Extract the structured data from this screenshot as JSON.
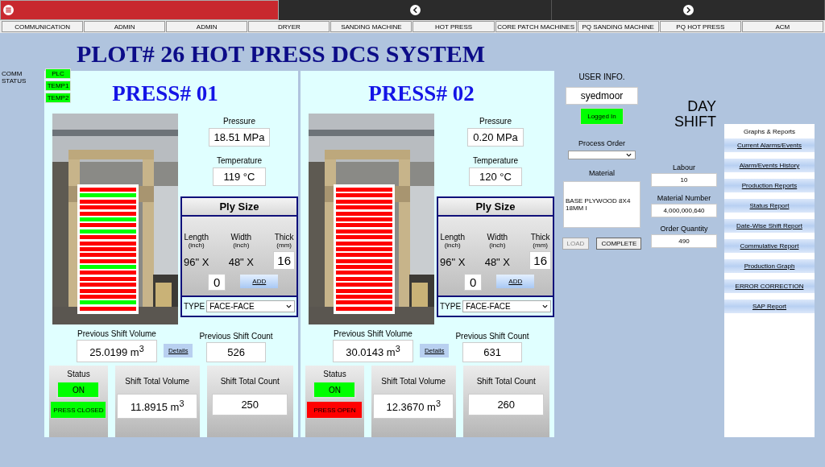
{
  "topbar": [
    {
      "kind": "menu",
      "selected": true
    },
    {
      "kind": "back",
      "selected": false
    },
    {
      "kind": "forward",
      "selected": false
    }
  ],
  "nav_tabs": [
    {
      "label": "COMMUNICATION",
      "selected": false
    },
    {
      "label": "ADMIN",
      "selected": false
    },
    {
      "label": "ADMIN",
      "selected": false
    },
    {
      "label": "DRYER",
      "selected": false
    },
    {
      "label": "SANDING MACHINE",
      "selected": false
    },
    {
      "label": "HOT PRESS",
      "selected": false
    },
    {
      "label": "CORE PATCH MACHINES",
      "selected": false
    },
    {
      "label": "PQ SANDING MACHINE",
      "selected": false
    },
    {
      "label": "PQ HOT PRESS",
      "selected": false
    },
    {
      "label": "ACM",
      "selected": false
    }
  ],
  "title": "PLOT# 26 HOT PRESS DCS SYSTEM",
  "comm_status": {
    "label": "COMM STATUS",
    "items": [
      {
        "label": "PLC",
        "ok": true
      },
      {
        "label": "TEMP1",
        "ok": true
      },
      {
        "label": "TEMP2",
        "ok": true
      }
    ]
  },
  "presses": [
    {
      "title": "PRESS# 01",
      "pressure_label": "Pressure",
      "pressure": "18.51 MPa",
      "temperature_label": "Temperature",
      "temperature": "119 °C",
      "plies": [
        {
          "color": "#ff0000"
        },
        {
          "color": "#00ff00"
        },
        {
          "color": "#ff0000"
        },
        {
          "color": "#ff0000"
        },
        {
          "color": "#ff0000"
        },
        {
          "color": "#00ff00"
        },
        {
          "color": "#ff0000"
        },
        {
          "color": "#00ff00"
        },
        {
          "color": "#ff0000"
        },
        {
          "color": "#ff0000"
        },
        {
          "color": "#ff0000"
        },
        {
          "color": "#ff0000"
        },
        {
          "color": "#ff0000"
        },
        {
          "color": "#00ff00"
        },
        {
          "color": "#ff0000"
        },
        {
          "color": "#ff0000"
        },
        {
          "color": "#ff0000"
        },
        {
          "color": "#ff0000"
        },
        {
          "color": "#ff0000"
        },
        {
          "color": "#00ff00"
        },
        {
          "color": "#ff0000"
        }
      ],
      "ply_size": {
        "title": "Ply Size",
        "columns": [
          {
            "label": "Length",
            "unit": "(inch)",
            "value": "96\" X",
            "kind": "text"
          },
          {
            "label": "Width",
            "unit": "(inch)",
            "value": "48\" X",
            "kind": "text"
          },
          {
            "label": "Thick",
            "unit": "(mm)",
            "value": "16",
            "kind": "field"
          }
        ],
        "count": "0",
        "add": "ADD",
        "type_label": "TYPE",
        "type": "FACE-FACE"
      },
      "prev_volume_label": "Previous Shift Volume",
      "prev_volume": "25.0199 m$^{3}$",
      "details": "Details",
      "prev_count_label": "Previous Shift Count",
      "prev_count": "526",
      "status_label": "Status",
      "status": "ON",
      "on": true,
      "press_state": "PRESS CLOSED",
      "closed": true,
      "total_volume_label": "Shift Total Volume",
      "total_volume": "11.8915 m$^{3}$",
      "total_count_label": "Shift Total Count",
      "total_count": "250"
    },
    {
      "title": "PRESS# 02",
      "pressure_label": "Pressure",
      "pressure": "0.20 MPa",
      "temperature_label": "Temperature",
      "temperature": "120 °C",
      "plies": [
        {
          "color": "#ff0000"
        },
        {
          "color": "#ff0000"
        },
        {
          "color": "#ff0000"
        },
        {
          "color": "#ff0000"
        },
        {
          "color": "#ff0000"
        },
        {
          "color": "#ff0000"
        },
        {
          "color": "#ff0000"
        },
        {
          "color": "#ff0000"
        },
        {
          "color": "#ff0000"
        },
        {
          "color": "#ff0000"
        },
        {
          "color": "#ff0000"
        },
        {
          "color": "#ff0000"
        },
        {
          "color": "#ff0000"
        },
        {
          "color": "#ff0000"
        },
        {
          "color": "#ff0000"
        },
        {
          "color": "#ff0000"
        },
        {
          "color": "#ff0000"
        },
        {
          "color": "#ff0000"
        },
        {
          "color": "#ff0000"
        },
        {
          "color": "#ff0000"
        },
        {
          "color": "#ff0000"
        }
      ],
      "ply_size": {
        "title": "Ply Size",
        "columns": [
          {
            "label": "Length",
            "unit": "(inch)",
            "value": "96\" X",
            "kind": "text"
          },
          {
            "label": "Width",
            "unit": "(inch)",
            "value": "48\" X",
            "kind": "text"
          },
          {
            "label": "Thick",
            "unit": "(mm)",
            "value": "16",
            "kind": "field"
          }
        ],
        "count": "0",
        "add": "ADD",
        "type_label": "TYPE",
        "type": "FACE-FACE"
      },
      "prev_volume_label": "Previous Shift Volume",
      "prev_volume": "30.0143 m$^{3}$",
      "details": "Details",
      "prev_count_label": "Previous Shift Count",
      "prev_count": "631",
      "status_label": "Status",
      "status": "ON",
      "on": true,
      "press_state": "PRESS OPEN",
      "closed": false,
      "total_volume_label": "Shift Total Volume",
      "total_volume": "12.3670 m$^{3}$",
      "total_count_label": "Shift Total Count",
      "total_count": "260"
    }
  ],
  "user": {
    "label": "USER INFO.",
    "name": "syedmoor",
    "status": "Logged In",
    "logged_in": true
  },
  "shift": "DAY SHIFT",
  "process_order_label": "Process Order",
  "material_label": "Material",
  "material": "BASE PLYWOOD 8X4 18MM I",
  "load": {
    "label": "LOAD",
    "disabled": true
  },
  "complete": {
    "label": "COMPLETE",
    "disabled": false
  },
  "labour_label": "Labour",
  "labour": "10",
  "material_number_label": "Material Number",
  "material_number": "4,000,000,640",
  "order_quantity_label": "Order Quantity",
  "order_quantity": "490",
  "reports": {
    "title": "Graphs & Reports",
    "links": [
      "Current Alarms/Events",
      "Alarm/Events History",
      "Production Reports",
      "Status Report",
      "Date-Wise Shift Report",
      "Commulative Report",
      "Production Graph",
      "ERROR CORRECTION",
      "SAP Report"
    ]
  }
}
